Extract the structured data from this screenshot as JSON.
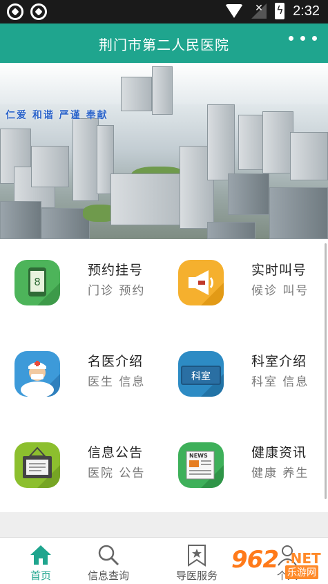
{
  "status_bar": {
    "time": "2:32",
    "icons": [
      "notification-icon",
      "notification-icon",
      "wifi-icon",
      "no-signal-icon",
      "battery-charging-icon"
    ]
  },
  "app_bar": {
    "title": "荆门市第二人民医院",
    "menu_icon": "more-dots-icon"
  },
  "banner": {
    "slogan": "仁爱 和谐 严谨 奉献"
  },
  "grid": {
    "items": [
      {
        "title": "预约挂号",
        "subtitle": "门诊 预约",
        "icon": "appointment-phone-icon",
        "color": "#4db45a"
      },
      {
        "title": "实时叫号",
        "subtitle": "候诊 叫号",
        "icon": "megaphone-icon",
        "color": "#f5b02e"
      },
      {
        "title": "名医介绍",
        "subtitle": "医生 信息",
        "icon": "doctor-icon",
        "color": "#3d9ad9"
      },
      {
        "title": "科室介绍",
        "subtitle": "科室 信息",
        "icon": "department-sign-icon",
        "color": "#2d8bc4"
      },
      {
        "title": "信息公告",
        "subtitle": "医院 公告",
        "icon": "notice-board-icon",
        "color": "#8cbf2e"
      },
      {
        "title": "健康资讯",
        "subtitle": "健康 养生",
        "icon": "newspaper-icon",
        "color": "#3eb05a"
      }
    ],
    "department_icon_text": "科室",
    "appointment_icon_text": "8",
    "news_icon_text": "NEWS"
  },
  "tabbar": {
    "tabs": [
      {
        "label": "首页",
        "icon": "home-icon",
        "active": true
      },
      {
        "label": "信息查询",
        "icon": "search-icon",
        "active": false
      },
      {
        "label": "导医服务",
        "icon": "bookmark-star-icon",
        "active": false
      },
      {
        "label": "个人",
        "icon": "person-icon",
        "active": false
      }
    ]
  },
  "watermark": {
    "number": "962",
    "suffix": ".NET",
    "text": "乐游网"
  },
  "colors": {
    "accent": "#1fa58e",
    "status_bar": "#1a1a1a"
  }
}
